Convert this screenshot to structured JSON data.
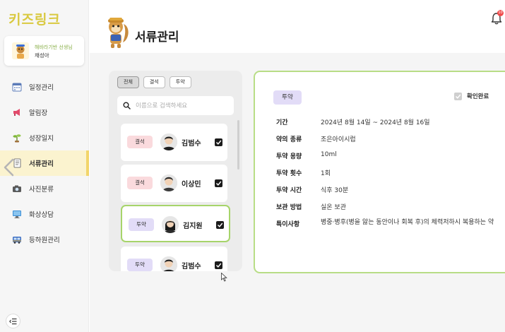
{
  "app": {
    "logo": "키즈링크"
  },
  "profile": {
    "role": "해바라기반 선생님",
    "name": "채성아"
  },
  "nav": [
    {
      "id": "schedule",
      "label": "일정관리",
      "icon": "calendar-icon"
    },
    {
      "id": "notice",
      "label": "알림장",
      "icon": "megaphone-icon"
    },
    {
      "id": "growth",
      "label": "성장일지",
      "icon": "sprout-icon"
    },
    {
      "id": "documents",
      "label": "서류관리",
      "icon": "document-icon",
      "active": true
    },
    {
      "id": "photos",
      "label": "사진분류",
      "icon": "camera-icon"
    },
    {
      "id": "video",
      "label": "화상상담",
      "icon": "monitor-icon"
    },
    {
      "id": "bus",
      "label": "등하원관리",
      "icon": "bus-icon"
    }
  ],
  "header": {
    "title": "서류관리",
    "notification_count": "10"
  },
  "filters": [
    {
      "label": "전체",
      "active": true
    },
    {
      "label": "결석",
      "active": false
    },
    {
      "label": "투약",
      "active": false
    }
  ],
  "search": {
    "placeholder": "이름으로 검색하세요",
    "value": ""
  },
  "students": [
    {
      "tag": "결석",
      "type": "absent",
      "name": "김범수",
      "checked": true
    },
    {
      "tag": "결석",
      "type": "absent",
      "name": "이상민",
      "checked": true
    },
    {
      "tag": "투약",
      "type": "med",
      "name": "김지원",
      "checked": true,
      "selected": true
    },
    {
      "tag": "투약",
      "type": "med",
      "name": "김범수",
      "checked": true
    }
  ],
  "detail": {
    "tag": "투약",
    "confirm_label": "확인완료",
    "confirmed": true,
    "rows": [
      {
        "label": "기간",
        "value": "2024년 8월 14일 ~ 2024년 8월 16일"
      },
      {
        "label": "약의 종류",
        "value": "조은아이시럽"
      },
      {
        "label": "투약 용량",
        "value": "10ml"
      },
      {
        "label": "투약 횟수",
        "value": "1회"
      },
      {
        "label": "투약 시간",
        "value": "식후 30분"
      },
      {
        "label": "보관 방법",
        "value": "실온 보관"
      },
      {
        "label": "특이사항",
        "value": "병중·병후(병을 앓는 동안이나 회복 후)의 체력저하시 복용하는 약"
      }
    ]
  },
  "colors": {
    "accent_green": "#b8dd86",
    "logo_yellow": "#d9c940",
    "absent_tag": "#fadadd",
    "med_tag": "#e2dcf7",
    "badge_red": "#f04b4b"
  }
}
